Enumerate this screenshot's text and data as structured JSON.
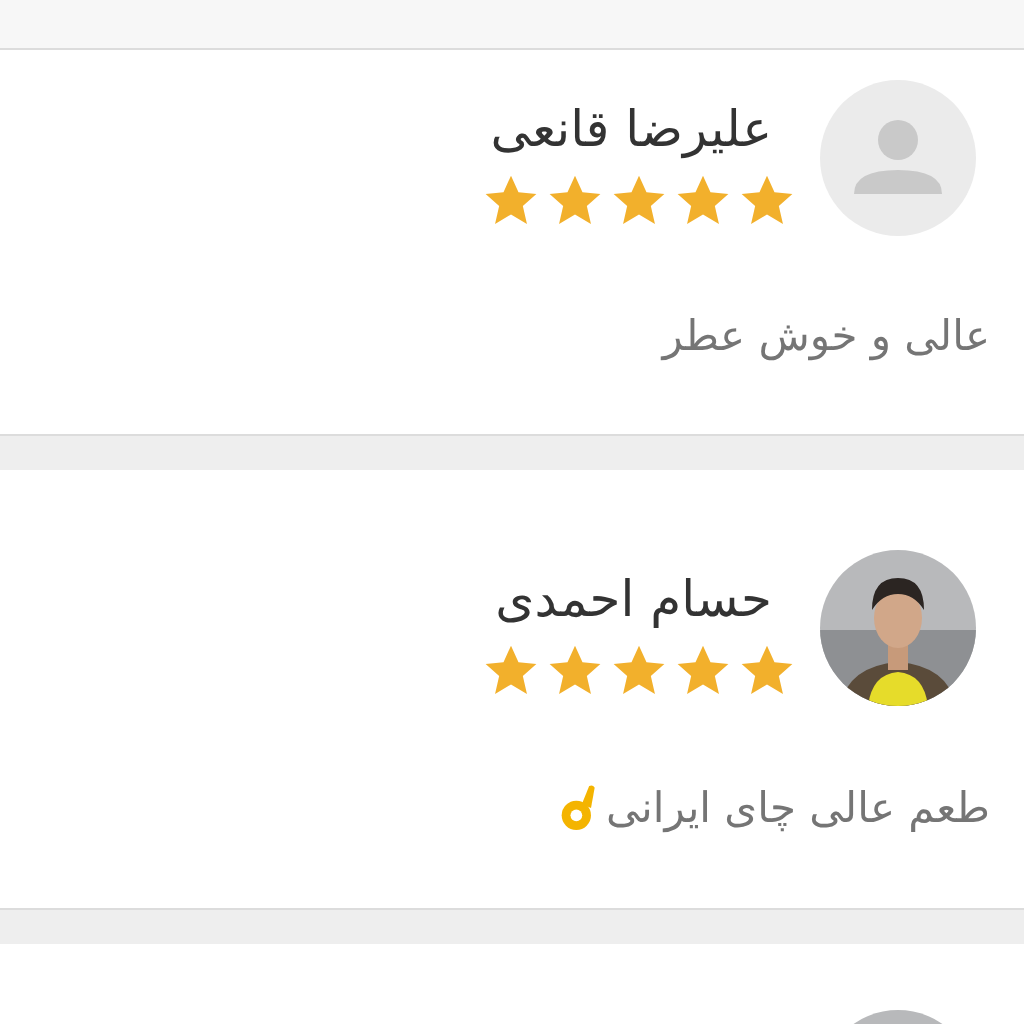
{
  "reviews": [
    {
      "kind": "placeholder",
      "name": "علیرضا قانعی",
      "stars": 5,
      "comment": "عالی و خوش عطر",
      "emoji": false
    },
    {
      "kind": "picture",
      "name": "حسام احمدی",
      "stars": 5,
      "comment": "طعم عالی چای ایرانی",
      "emoji": true
    },
    {
      "kind": "picture"
    }
  ]
}
